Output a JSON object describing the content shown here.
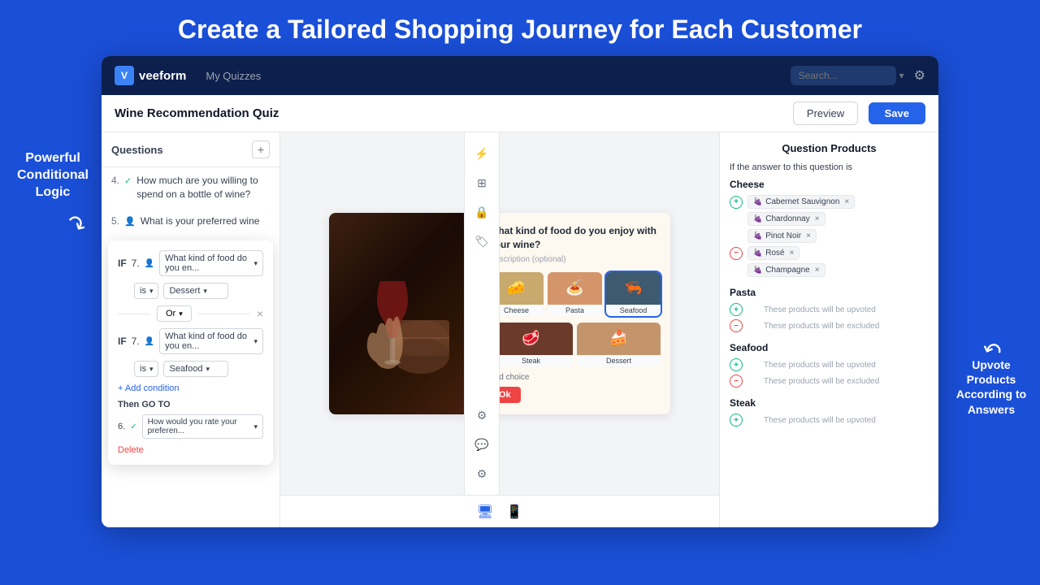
{
  "page": {
    "title": "Create a Tailored Shopping Journey for Each Customer",
    "annotation_left": "Powerful Conditional Logic",
    "annotation_right": "Upvote Products According to Answers"
  },
  "nav": {
    "logo": "veeform",
    "logo_icon": "V",
    "nav_link": "My Quizzes",
    "search_placeholder": "Search...",
    "gear_icon": "⚙"
  },
  "sub_header": {
    "quiz_title": "Wine Recommendation Quiz",
    "preview_btn": "Preview",
    "save_btn": "Save"
  },
  "questions": {
    "header": "Questions",
    "add_btn": "+",
    "items": [
      {
        "num": "4.",
        "icon": "check",
        "text": "How much are you willing to spend on a bottle of wine?"
      },
      {
        "num": "5.",
        "icon": "person",
        "text": "What is your preferred wine"
      }
    ]
  },
  "logic_box": {
    "if1": "IF",
    "q_num1": "7.",
    "q_text1": "What kind of food do you en...",
    "is_label1": "is",
    "value1": "Dessert",
    "or_label": "Or",
    "if2": "IF",
    "q_num2": "7.",
    "q_text2": "What kind of food do you en...",
    "is_label2": "is",
    "value2": "Seafood",
    "add_condition": "+ Add condition",
    "then_goto": "Then GO TO",
    "goto_num": "6.",
    "goto_text": "How would you rate your preferen...",
    "delete_label": "Delete"
  },
  "quiz_card": {
    "question": "What kind of food do you enjoy with your wine?",
    "question_bold": "food",
    "description": "Description (optional)",
    "ok_btn": "Ok",
    "add_choice": "Add choice",
    "foods": [
      {
        "label": "Cheese",
        "emoji": "🧀",
        "bg": "#c8a96e"
      },
      {
        "label": "Pasta",
        "emoji": "🍝",
        "bg": "#d4956a"
      },
      {
        "label": "Seafood",
        "emoji": "🦐",
        "bg": "#3d5a6e"
      },
      {
        "label": "Steak",
        "emoji": "🥩",
        "bg": "#6b3a2a"
      },
      {
        "label": "Dessert",
        "emoji": "🍰",
        "bg": "#c4956a"
      }
    ]
  },
  "right_panel": {
    "title": "Question Products",
    "condition_text": "If the answer to this question is",
    "sections": [
      {
        "name": "Cheese",
        "upvote_products": [
          "Cabernet Sauvignon",
          "Chardonnay",
          "Pinot Noir"
        ],
        "exclude_products": [
          "Rosé",
          "Champagne"
        ],
        "upvote_placeholder": "",
        "exclude_placeholder": ""
      },
      {
        "name": "Pasta",
        "upvote_products": [],
        "exclude_products": [],
        "upvote_placeholder": "These products will be upvoted",
        "exclude_placeholder": "These products will be excluded"
      },
      {
        "name": "Seafood",
        "upvote_products": [],
        "exclude_products": [],
        "upvote_placeholder": "These products will be upvoted",
        "exclude_placeholder": "These products will be excluded"
      },
      {
        "name": "Steak",
        "upvote_products": [],
        "exclude_products": [],
        "upvote_placeholder": "These products will be upvoted",
        "exclude_placeholder": ""
      }
    ]
  },
  "bottom_bar": {
    "desktop_icon": "🖥",
    "mobile_icon": "📱"
  }
}
